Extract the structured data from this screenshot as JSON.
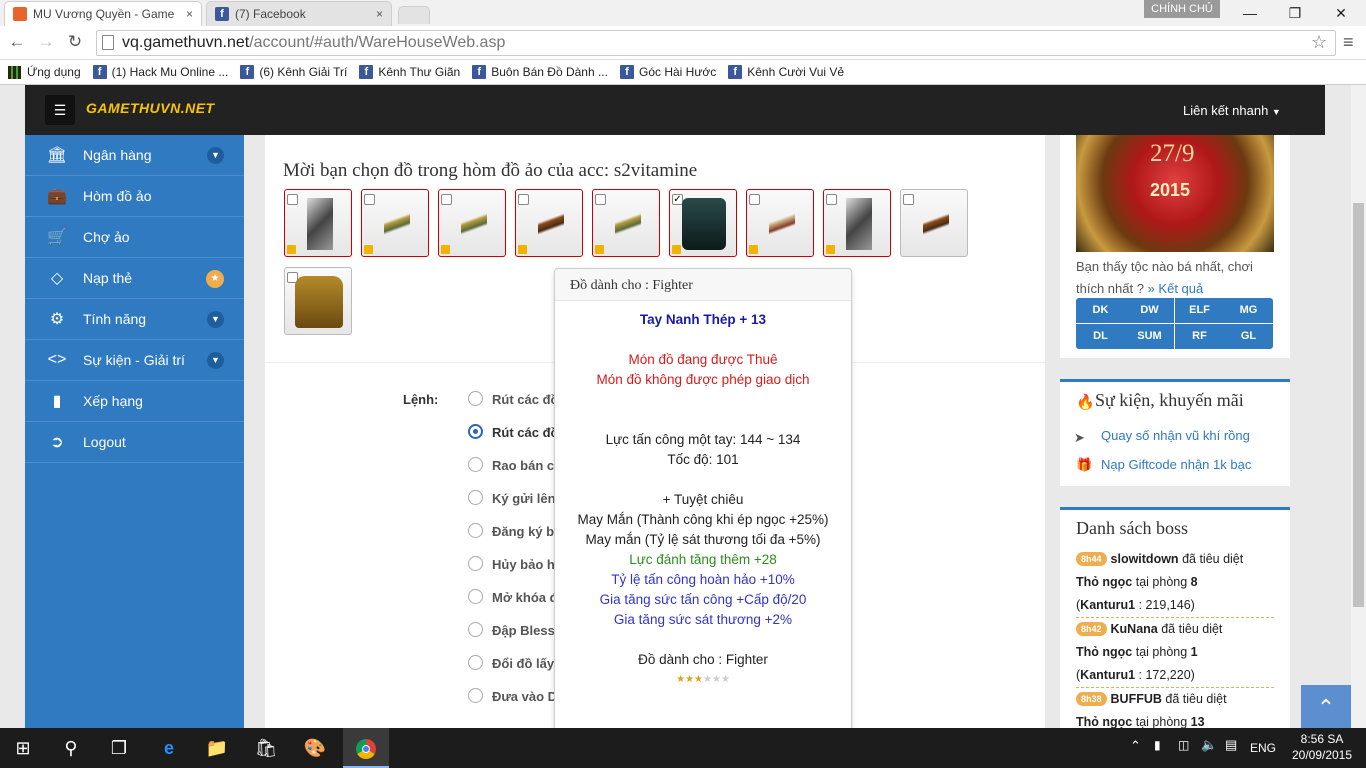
{
  "browser": {
    "tabs": [
      {
        "title": "MU Vương Quyền - Game",
        "close": "×"
      },
      {
        "title": "(7) Facebook",
        "close": "×"
      }
    ],
    "owner_badge": "CHÍNH CHỦ",
    "url_host": "vq.gamethuvn.net",
    "url_path": "/account/#auth/WareHouseWeb.asp",
    "bookmarks": [
      "Ứng dụng",
      "(1) Hack Mu Online ...",
      "(6) Kênh Giải Trí",
      "Kênh Thư Giãn",
      "Buôn Bán Đồ Dành ...",
      "Góc Hài Hước",
      "Kênh Cười Vui Vẻ"
    ]
  },
  "header": {
    "logo": "GAMETHUVN.NET",
    "quick_link": "Liên kết nhanh"
  },
  "sidebar": {
    "items": [
      {
        "label": "Ngân hàng",
        "icon": "bank-icon"
      },
      {
        "label": "Hòm đồ ảo",
        "icon": "briefcase-icon"
      },
      {
        "label": "Chợ ảo",
        "icon": "cart-icon"
      },
      {
        "label": "Nạp thẻ",
        "icon": "diamond-icon"
      },
      {
        "label": "Tính năng",
        "icon": "gears-icon"
      },
      {
        "label": "Sự kiện - Giải trí",
        "icon": "share-icon"
      },
      {
        "label": "Xếp hạng",
        "icon": "bar-chart-icon"
      },
      {
        "label": "Logout",
        "icon": "logout-icon"
      }
    ]
  },
  "warehouse": {
    "prompt": "Mời bạn chọn đồ trong hòm đồ ảo của acc: s2vitamine",
    "command_label": "Lệnh:",
    "options": [
      "Rút các đồ",
      "Rút các đồ",
      "Rao bán các",
      "Ký gửi lên",
      "Đăng ký b",
      "Hủy bảo h",
      "Mở khóa đ",
      "Đập Bless",
      "Đổi đồ lấy",
      "Đưa vào D"
    ],
    "selected_option_index": 1
  },
  "tooltip": {
    "header": "Đồ dành cho : Fighter",
    "item_name": "Tay Nanh Thép + 13",
    "rent_line": "Món đồ đang được Thuê",
    "trade_line": "Món đồ không được phép giao dịch",
    "attack": "Lực tấn công một tay: 144 ~ 134",
    "speed": "Tốc độ: 101",
    "skill": "+ Tuyệt chiêu",
    "luck1": "May Mắn (Thành công khi ép ngọc +25%)",
    "luck2": "May mắn (Tỷ lệ sát thương tối đa +5%)",
    "opt_green": "Lực đánh tăng thêm +28",
    "opt_blue1": "Tỷ lệ tấn công hoàn hảo +10%",
    "opt_blue2": "Gia tăng sức tấn công +Cấp độ/20",
    "opt_blue3": "Gia tăng sức sát thương +2%",
    "footer": "Đồ dành cho : Fighter",
    "rating": 3,
    "rating_max": 6,
    "colors": {
      "title": "#1a1aa8",
      "red": "#d91b1b",
      "green": "#2e8b1e",
      "blue": "#3333cc"
    }
  },
  "event": {
    "date": "27/9",
    "year": "2015",
    "question": "Bạn thấy tộc nào bá nhất, chơi thích nhất ?",
    "result_link": "» Kết quả",
    "classes": [
      "DK",
      "DW",
      "ELF",
      "MG",
      "DL",
      "SUM",
      "RF",
      "GL"
    ]
  },
  "promo": {
    "title": "Sự kiện, khuyến mãi",
    "links": [
      "Quay số nhận vũ khí rồng",
      "Nạp Giftcode nhận 1k bạc"
    ]
  },
  "bosses": {
    "title": "Danh sách boss",
    "entries": [
      {
        "time": "8h44",
        "player": "slowitdown",
        "action": "đã tiêu diệt",
        "boss": "Thỏ ngọc",
        "where": "tại phòng",
        "room": "8",
        "killer": "Kanturu1",
        "score": ": 219,146)"
      },
      {
        "time": "8h42",
        "player": "KuNana",
        "action": "đã tiêu diệt",
        "boss": "Thỏ ngọc",
        "where": "tại phòng",
        "room": "1",
        "killer": "Kanturu1",
        "score": ": 172,220)"
      },
      {
        "time": "8h38",
        "player": "BUFFUB",
        "action": "đã tiêu diệt",
        "boss": "Thỏ ngọc",
        "where": "tại phòng",
        "room": "13",
        "killer": "",
        "score": ""
      }
    ]
  },
  "taskbar": {
    "lang": "ENG",
    "time": "8:56 SA",
    "date": "20/09/2015"
  }
}
